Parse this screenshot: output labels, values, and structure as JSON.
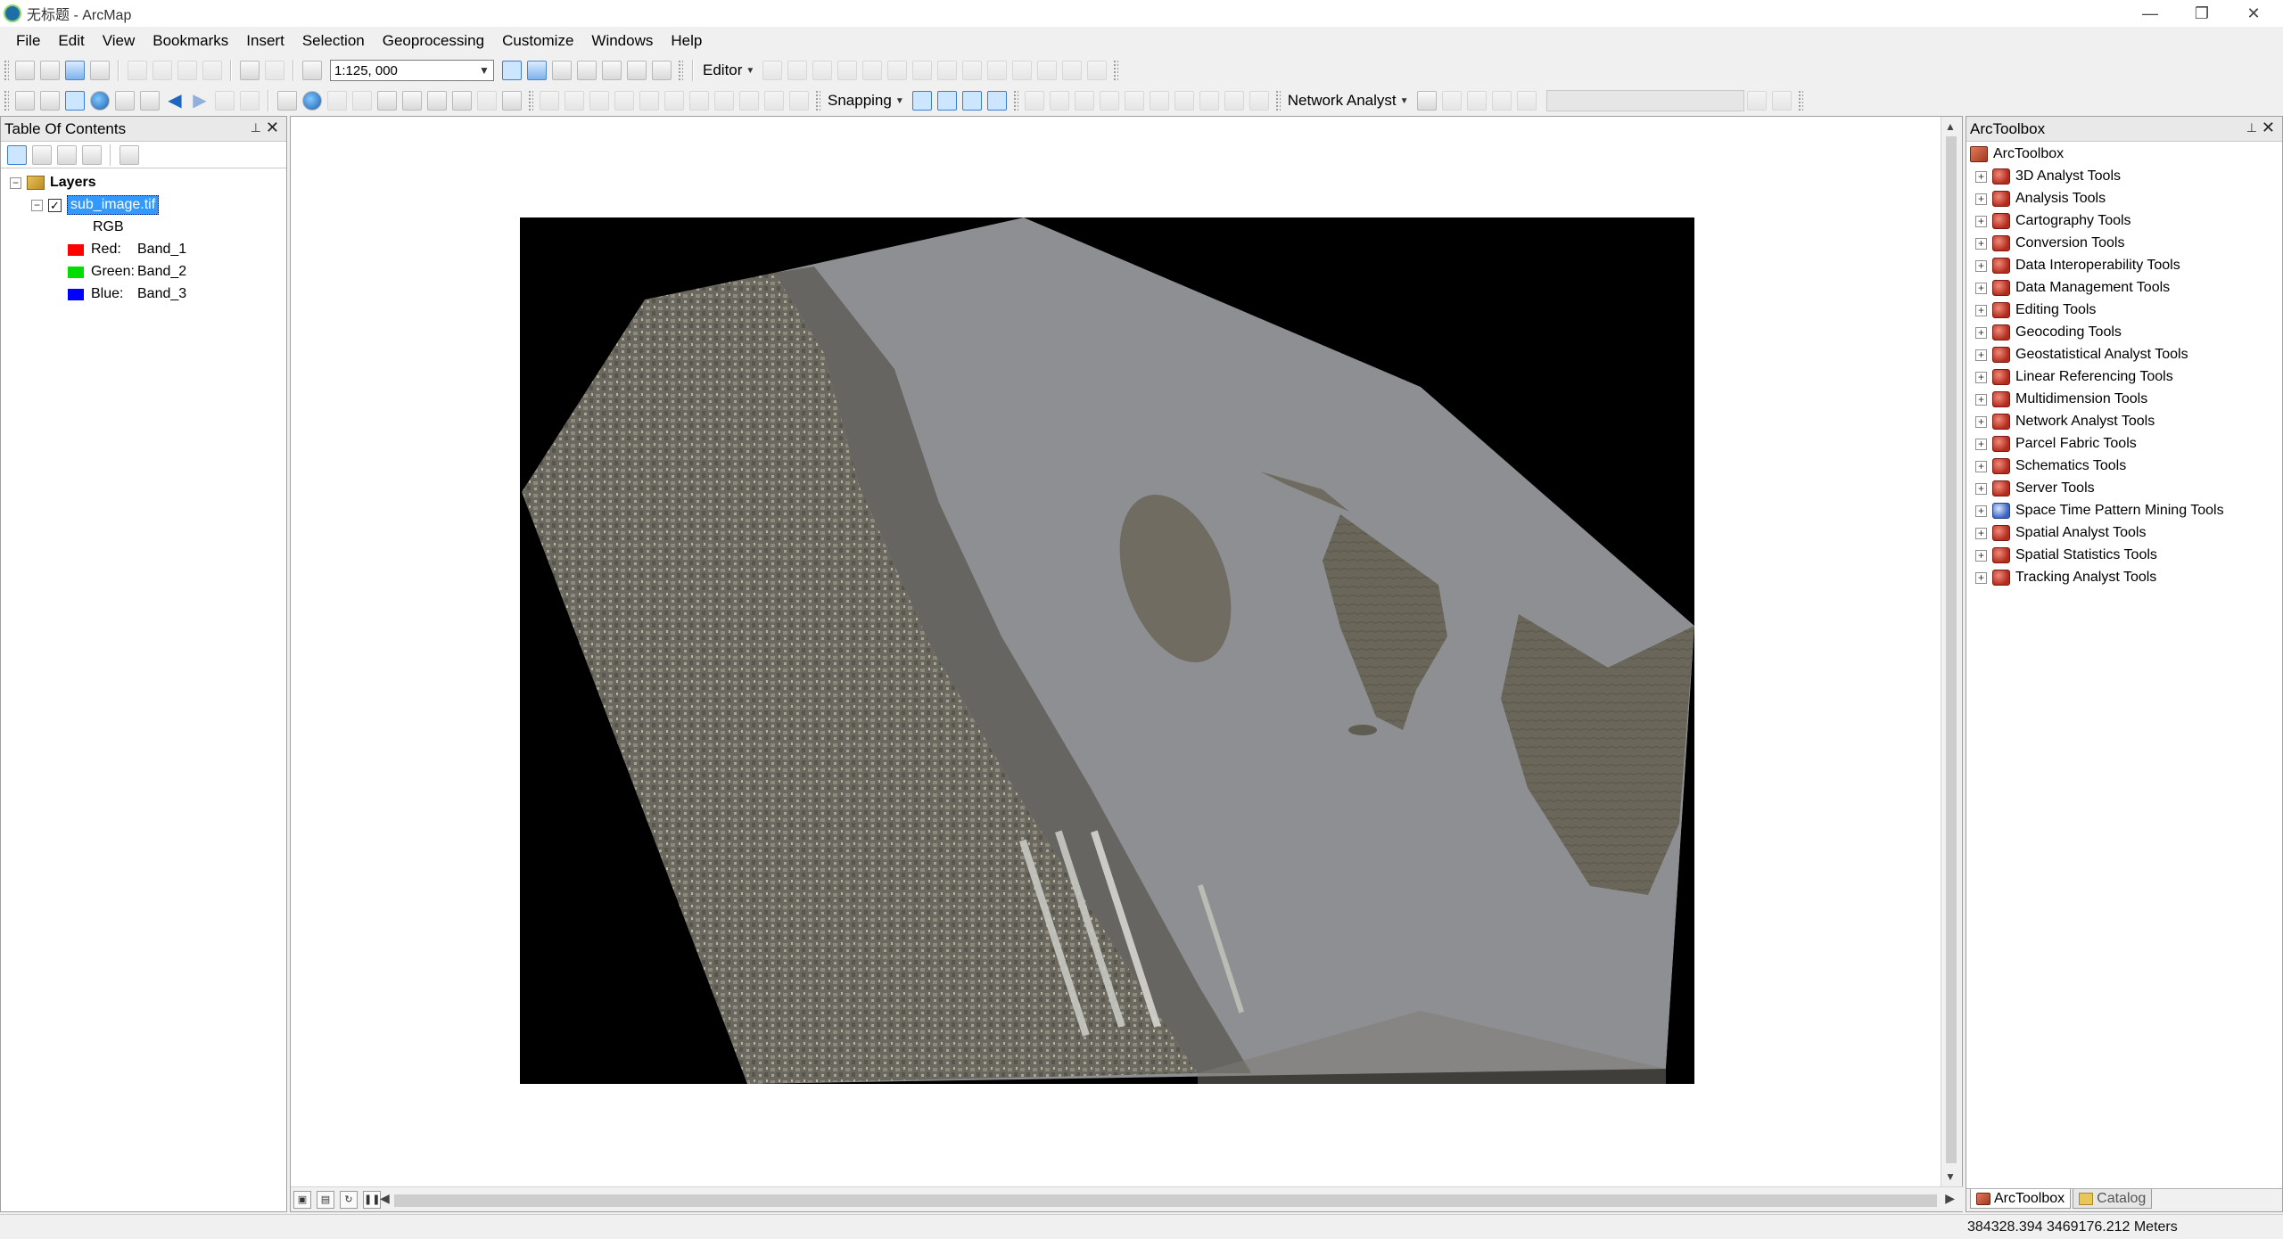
{
  "window": {
    "title": "无标题 - ArcMap",
    "controls": [
      "—",
      "❐",
      "✕"
    ]
  },
  "menu": [
    "File",
    "Edit",
    "View",
    "Bookmarks",
    "Insert",
    "Selection",
    "Geoprocessing",
    "Customize",
    "Windows",
    "Help"
  ],
  "toolbar": {
    "scale": "1:125, 000",
    "editor_label": "Editor",
    "snapping_label": "Snapping",
    "network_analyst_label": "Network Analyst"
  },
  "toc": {
    "title": "Table Of Contents",
    "pin_glyph": "⊥",
    "close_glyph": "✕",
    "root_label": "Layers",
    "layer_name": "sub_image.tif",
    "render_label": "RGB",
    "bands": [
      {
        "channel": "Red:",
        "band": "Band_1",
        "color": "#ff0000"
      },
      {
        "channel": "Green:",
        "band": "Band_2",
        "color": "#00dd00"
      },
      {
        "channel": "Blue:",
        "band": "Band_3",
        "color": "#0000ff"
      }
    ]
  },
  "toolbox": {
    "title": "ArcToolbox",
    "root_label": "ArcToolbox",
    "items": [
      "3D Analyst Tools",
      "Analysis Tools",
      "Cartography Tools",
      "Conversion Tools",
      "Data Interoperability Tools",
      "Data Management Tools",
      "Editing Tools",
      "Geocoding Tools",
      "Geostatistical Analyst Tools",
      "Linear Referencing Tools",
      "Multidimension Tools",
      "Network Analyst Tools",
      "Parcel Fabric Tools",
      "Schematics Tools",
      "Server Tools",
      "Space Time Pattern Mining Tools",
      "Spatial Analyst Tools",
      "Spatial Statistics Tools",
      "Tracking Analyst Tools"
    ],
    "tabs": [
      "ArcToolbox",
      "Catalog"
    ]
  },
  "status": {
    "coords": "384328.394  3469176.212 Meters"
  },
  "colors": {
    "selection": "#3399ff",
    "water": "#8e8f92",
    "urban": "#6f6c63",
    "wetland": "#6b6659"
  }
}
